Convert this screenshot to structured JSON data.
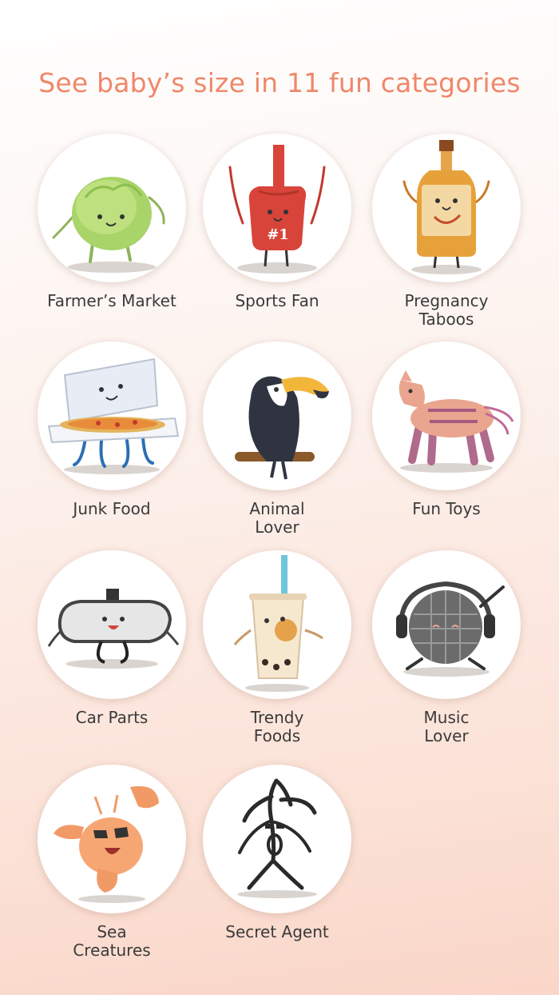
{
  "headline": "See baby’s size in 11  fun categories",
  "categories": [
    {
      "label": "Farmer’s Market",
      "icon": "lettuce-icon"
    },
    {
      "label": "Sports Fan",
      "icon": "foam-finger-icon"
    },
    {
      "label": "Pregnancy\nTaboos",
      "icon": "whiskey-bottle-icon"
    },
    {
      "label": "Junk Food",
      "icon": "pizza-box-icon"
    },
    {
      "label": "Animal\nLover",
      "icon": "toucan-icon"
    },
    {
      "label": "Fun Toys",
      "icon": "pinata-icon"
    },
    {
      "label": "Car Parts",
      "icon": "rearview-mirror-icon"
    },
    {
      "label": "Trendy\nFoods",
      "icon": "bubble-tea-icon"
    },
    {
      "label": "Music\nLover",
      "icon": "disco-ball-icon"
    },
    {
      "label": "Sea\nCreatures",
      "icon": "shrimp-icon"
    },
    {
      "label": "Secret Agent",
      "icon": "stick-figure-icon"
    }
  ],
  "finger_text": "#1"
}
